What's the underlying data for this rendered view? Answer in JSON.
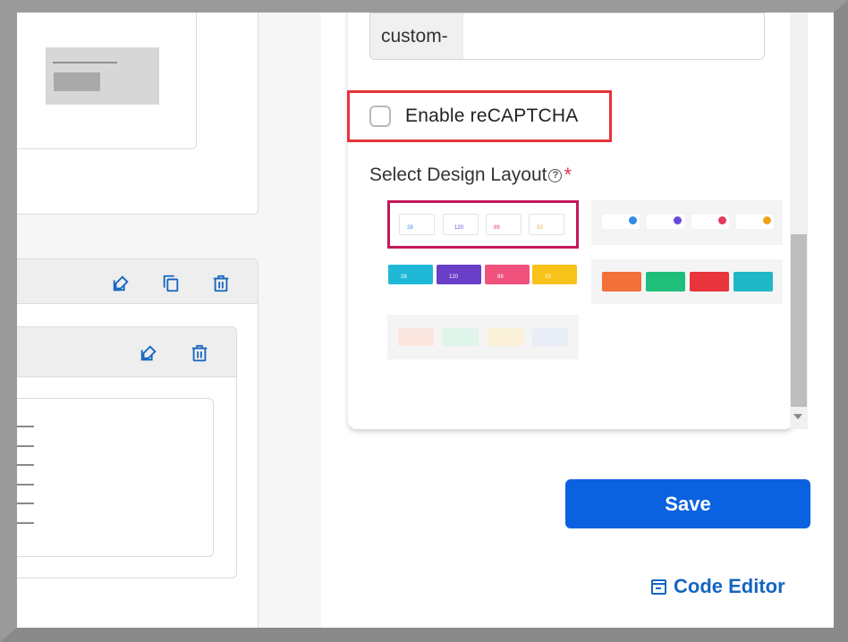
{
  "form": {
    "prefix_addon": "custom-",
    "prefix_input_value": "",
    "recaptcha_label": "Enable reCAPTCHA",
    "recaptcha_checked": false,
    "layout_title": "Select Design Layout",
    "help_icon": "?",
    "required_mark": "*",
    "save_label": "Save",
    "code_editor_label": "Code Editor"
  },
  "layouts": {
    "selected_index": 0,
    "option_1": {
      "values": [
        "28",
        "120",
        "89",
        "10"
      ]
    },
    "option_3": {
      "values": [
        "28",
        "120",
        "89",
        "10"
      ]
    }
  },
  "colors": {
    "save_button": "#0b62e0",
    "link": "#1565c0",
    "highlight_box": "#e6333b",
    "selected_layout_border": "#c2185b",
    "required": "#e0334a"
  },
  "icons": {
    "edit": "edit-icon",
    "copy": "copy-icon",
    "delete": "trash-icon",
    "code": "code-editor-icon"
  }
}
